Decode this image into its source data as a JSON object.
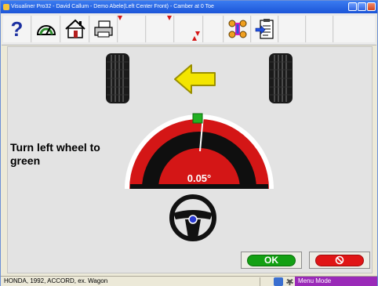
{
  "window": {
    "title": "Visualiner Pro32 - David Callum - Demo Abele(Left Center Front) - Camber at 0 Toe"
  },
  "toolbar": {
    "icons": [
      "help-icon",
      "gauge-icon",
      "home-icon",
      "printer-icon",
      "vehicle-specs-icon",
      "clipboard-icon"
    ]
  },
  "main": {
    "instruction": "Turn left wheel to green",
    "gauge_value": "0.05°",
    "direction": "left",
    "colors": {
      "accent_yellow": "#f3e500",
      "gauge_red": "#d41616",
      "gauge_target": "#22b022",
      "ok_green": "#13a013",
      "cancel_red": "#e01515"
    }
  },
  "buttons": {
    "ok_label": "OK",
    "cancel_icon": "prohibited-icon"
  },
  "status": {
    "vehicle": "HONDA, 1992, ACCORD, ex. Wagon",
    "mode": "Menu Mode"
  }
}
